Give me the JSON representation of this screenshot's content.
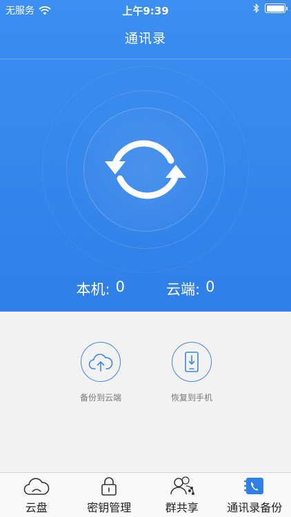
{
  "status_bar": {
    "carrier": "无服务",
    "time": "上午9:39"
  },
  "nav": {
    "title": "通讯录"
  },
  "counts": {
    "local_label": "本机:",
    "local_value": "0",
    "cloud_label": "云端:",
    "cloud_value": "0"
  },
  "actions": {
    "backup_label": "备份到云端",
    "restore_label": "恢复到手机"
  },
  "tabs": [
    {
      "label": "云盘",
      "icon": "cloud-icon"
    },
    {
      "label": "密钥管理",
      "icon": "lock-icon"
    },
    {
      "label": "群共享",
      "icon": "group-icon"
    },
    {
      "label": "通讯录备份",
      "icon": "contacts-backup-icon",
      "active": true
    }
  ],
  "colors": {
    "primary": "#2f7fe8",
    "accent": "#3a86e8",
    "background": "#f2f2f2"
  }
}
